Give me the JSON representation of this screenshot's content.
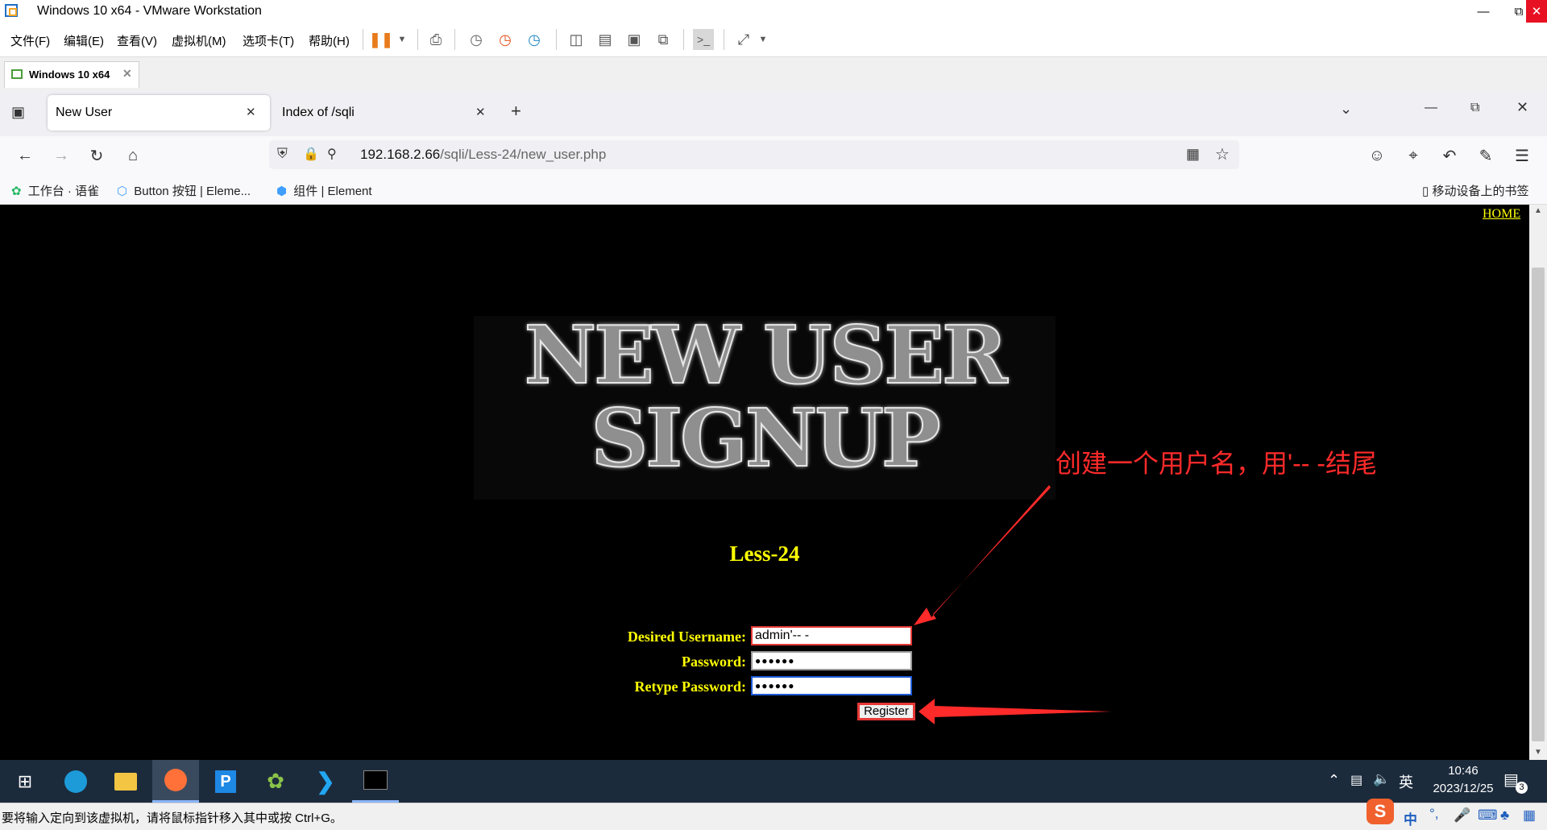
{
  "vmware": {
    "window_title": "Windows 10 x64 - VMware Workstation",
    "menu": [
      "文件(F)",
      "编辑(E)",
      "查看(V)",
      "虚拟机(M)",
      "选项卡(T)",
      "帮助(H)"
    ],
    "vm_tab": "Windows 10 x64",
    "status_text": "要将输入定向到该虚拟机，请将鼠标指针移入其中或按 Ctrl+G。"
  },
  "browser": {
    "tabs": [
      {
        "title": "New User",
        "active": true
      },
      {
        "title": "Index of /sqli",
        "active": false
      }
    ],
    "url_host": "192.168.2.66",
    "url_path": "/sqli/Less-24/new_user.php",
    "bookmarks": [
      "工作台 · 语雀",
      "Button 按钮 | Eleme...",
      "组件 | Element"
    ],
    "mobile_bookmarks": "移动设备上的书签"
  },
  "page": {
    "home_link": "HOME",
    "banner_line1": "NEW USER",
    "banner_line2": "SIGNUP",
    "lesson": "Less-24",
    "form": {
      "username_label": "Desired Username:",
      "username_value": "admin'-- -",
      "password_label": "Password:",
      "password_value": "●●●●●●",
      "retype_label": "Retype Password:",
      "retype_value": "●●●●●●",
      "register_button": "Register"
    },
    "annotation": "创建一个用户名，用'-- -结尾",
    "colors": {
      "label": "#ffff00",
      "annotation": "#ff2a2a",
      "background": "#000000"
    }
  },
  "taskbar": {
    "time": "10:46",
    "date": "2023/12/25",
    "ime_lang": "英",
    "notification_count": "3",
    "tray_ime": "中"
  }
}
